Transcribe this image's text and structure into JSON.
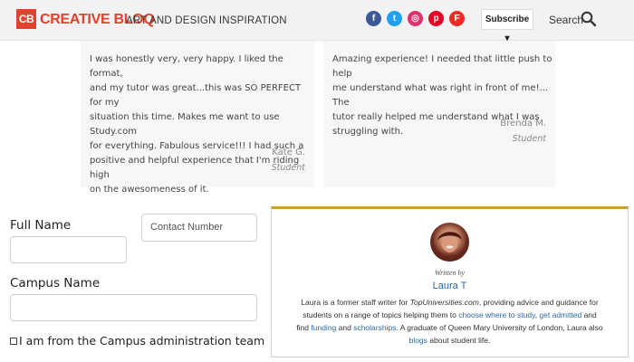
{
  "header": {
    "logo_mark": "CB",
    "logo_text": "CREATIVE BLOQ",
    "tagline": "ART AND DESIGN INSPIRATION",
    "social_icons": [
      {
        "name": "facebook-icon",
        "color": "#3b5998",
        "glyph": "f"
      },
      {
        "name": "twitter-icon",
        "color": "#1da1f2",
        "glyph": "t"
      },
      {
        "name": "instagram-icon",
        "color": "#e1306c",
        "glyph": "◎"
      },
      {
        "name": "pinterest-icon",
        "color": "#e60023",
        "glyph": "p"
      },
      {
        "name": "flipboard-icon",
        "color": "#f52828",
        "glyph": "F"
      }
    ],
    "subscribe_label": "Subscribe ▾",
    "search_label": "Search"
  },
  "testimonials": [
    {
      "lines": [
        "I was honestly very, very happy. I liked the format,",
        "and my tutor was great...this was SO PERFECT for my",
        "situation this time. Makes me want to use Study.com",
        "for everything. Fabulous service!!! I had such a",
        "positive and helpful experience that I'm riding high",
        "on the awesomeness of it."
      ],
      "name": "Kate G.",
      "role": "Student"
    },
    {
      "lines": [
        "Amazing experience! I needed that little push to help",
        "me understand what was right in front of me!... The",
        "tutor really helped me understand what I was",
        "struggling with."
      ],
      "name": "Brenda M.",
      "role": "Student"
    }
  ],
  "form": {
    "full_name_label": "Full Name",
    "contact_placeholder": "Contact Number",
    "campus_label": "Campus Name",
    "checkbox_label": "I am from the Campus administration team"
  },
  "author": {
    "written_by": "Written by",
    "name": "Laura T",
    "bio": {
      "l1_a": "Laura is a former staff writer for ",
      "l1_site": "TopUniversities.com",
      "l1_b": ", providing advice and guidance for",
      "l2_a": "students on a range of topics helping them to ",
      "l2_link1": "choose where to study",
      "l2_sep": ", ",
      "l2_link2": "get admitted",
      "l2_b": " and",
      "l3_a": "find ",
      "l3_link1": "funding",
      "l3_and": " and ",
      "l3_link2": "scholarships",
      "l3_b": ". A graduate of Queen Mary University of London, Laura also",
      "l4_link": "blogs",
      "l4_b": " about student life."
    }
  },
  "colors": {
    "brand": "#e2412b",
    "link": "#2a6aa6",
    "card_accent": "#cf9d35"
  }
}
